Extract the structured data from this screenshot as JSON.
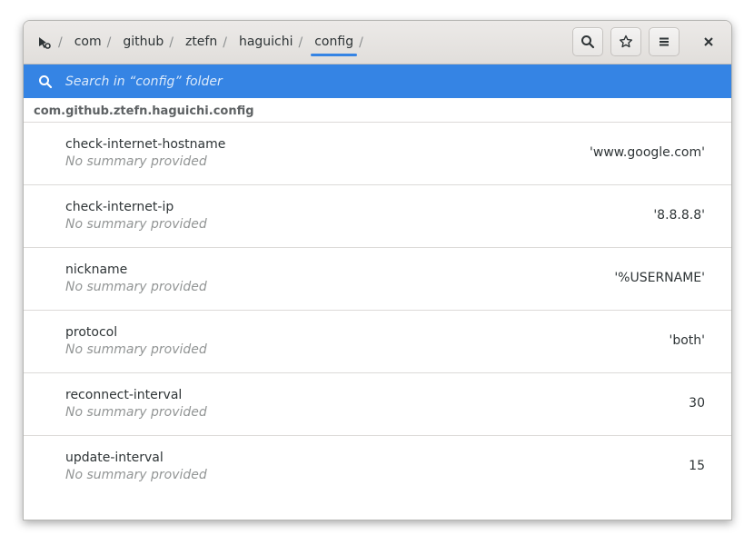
{
  "header": {
    "breadcrumbs": [
      "com",
      "github",
      "ztefn",
      "haguichi",
      "config"
    ],
    "separator": "/",
    "home_icon": "dconf-editor-icon",
    "buttons": {
      "search_icon": "search-icon",
      "bookmark_icon": "star-icon",
      "menu_icon": "hamburger-menu-icon",
      "close_icon": "close-icon"
    }
  },
  "search": {
    "placeholder": "Search in “config” folder"
  },
  "path_header": "com.github.ztefn.haguichi.config",
  "rows": [
    {
      "name": "check-internet-hostname",
      "summary": "No summary provided",
      "value": "'www.google.com'"
    },
    {
      "name": "check-internet-ip",
      "summary": "No summary provided",
      "value": "'8.8.8.8'"
    },
    {
      "name": "nickname",
      "summary": "No summary provided",
      "value": "'%USERNAME'"
    },
    {
      "name": "protocol",
      "summary": "No summary provided",
      "value": "'both'"
    },
    {
      "name": "reconnect-interval",
      "summary": "No summary provided",
      "value": "30"
    },
    {
      "name": "update-interval",
      "summary": "No summary provided",
      "value": "15"
    }
  ],
  "colors": {
    "accent": "#3584e4",
    "text": "#2e3436",
    "dim_text": "#929595"
  }
}
